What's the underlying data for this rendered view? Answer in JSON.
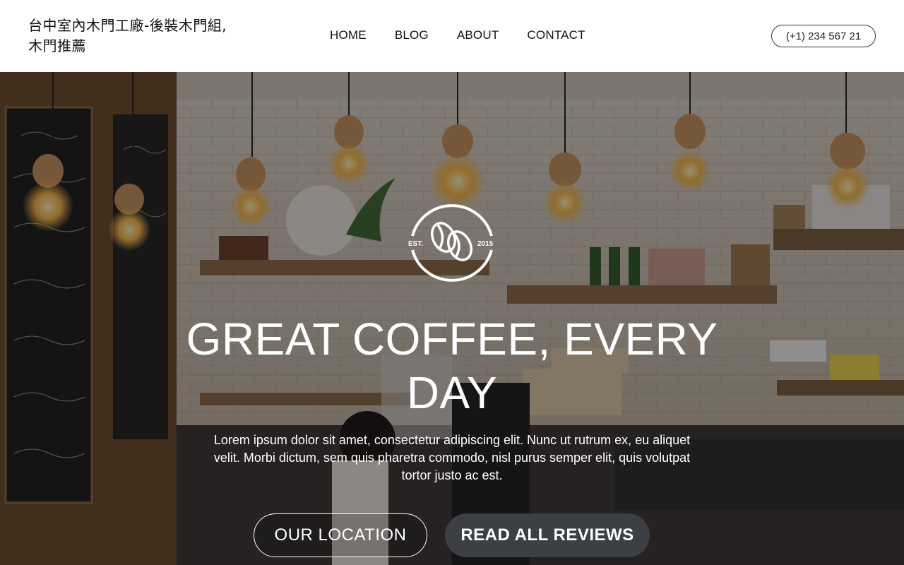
{
  "header": {
    "site_title": "台中室內木門工廠-後裝木門組,木門推薦",
    "nav": [
      {
        "label": "HOME"
      },
      {
        "label": "BLOG"
      },
      {
        "label": "ABOUT"
      },
      {
        "label": "CONTACT"
      }
    ],
    "phone": "(+1) 234 567 21"
  },
  "hero": {
    "logo": {
      "left_text": "EST.",
      "right_text": "2015",
      "icon": "coffee-beans-icon"
    },
    "headline": "GREAT COFFEE, EVERY DAY",
    "lede": "Lorem ipsum dolor sit amet, consectetur adipiscing elit. Nunc ut rutrum ex, eu aliquet velit. Morbi dictum, sem quis pharetra commodo, nisl purus semper elit, quis volutpat tortor justo ac est.",
    "buttons": {
      "primary": "OUR LOCATION",
      "secondary": "READ ALL REVIEWS"
    }
  },
  "colors": {
    "header_bg": "#ffffff",
    "solid_button": "#3c3f43",
    "overlay": "#0a0806"
  }
}
